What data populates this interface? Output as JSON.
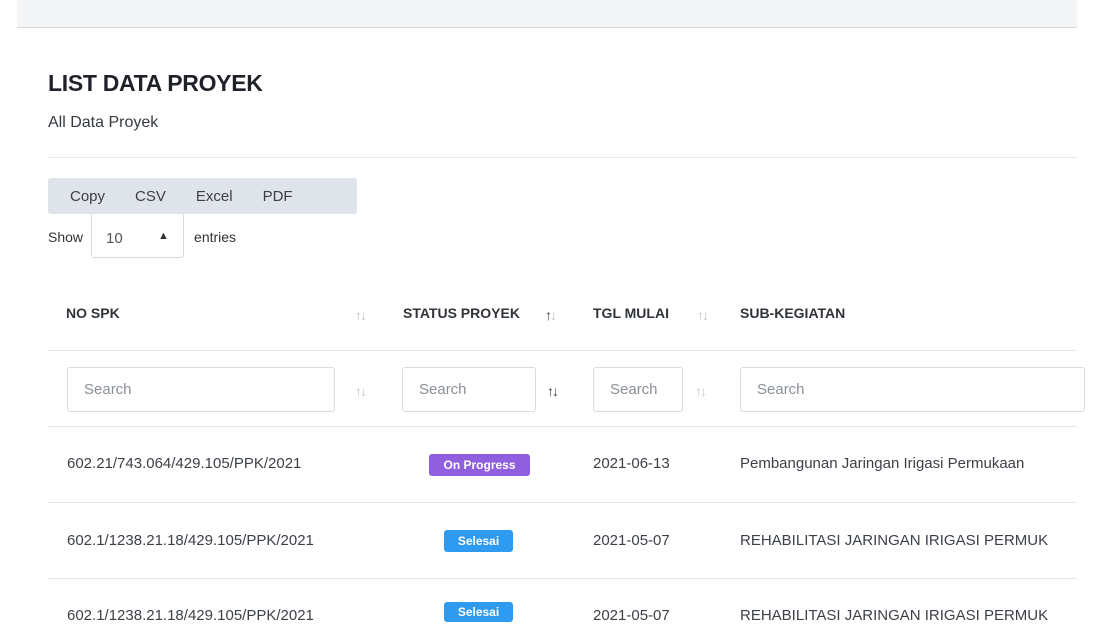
{
  "card": {
    "title": "LIST DATA PROYEK",
    "subtitle": "All Data Proyek"
  },
  "buttons": [
    "Copy",
    "CSV",
    "Excel",
    "PDF"
  ],
  "length": {
    "show_label": "Show",
    "value": "10",
    "entries_label": "entries"
  },
  "columns": [
    {
      "label": "NO SPK",
      "sort": "none"
    },
    {
      "label": "STATUS PROYEK",
      "sort": "ascending"
    },
    {
      "label": "TGL MULAI",
      "sort": "none"
    },
    {
      "label": "SUB-KEGIATAN",
      "sort": "none"
    }
  ],
  "search_placeholder": "Search",
  "sort_icon": "↑↓",
  "rows": [
    {
      "no_spk": "602.21/743.064/429.105/PPK/2021",
      "status": "On Progress",
      "tgl": "2021-06-13",
      "sub": "Pembangunan Jaringan Irigasi Permukaan"
    },
    {
      "no_spk": "602.1/1238.21.18/429.105/PPK/2021",
      "status": "Selesai",
      "tgl": "2021-05-07",
      "sub": "REHABILITASI JARINGAN IRIGASI PERMUK"
    },
    {
      "no_spk": "602.1/1238.21.18/429.105/PPK/2021",
      "status": "Selesai",
      "tgl": "2021-05-07",
      "sub": "REHABILITASI JARINGAN IRIGASI PERMUK"
    }
  ],
  "colors": {
    "on_progress": "#8f5fe0",
    "selesai": "#2f9bf0"
  }
}
